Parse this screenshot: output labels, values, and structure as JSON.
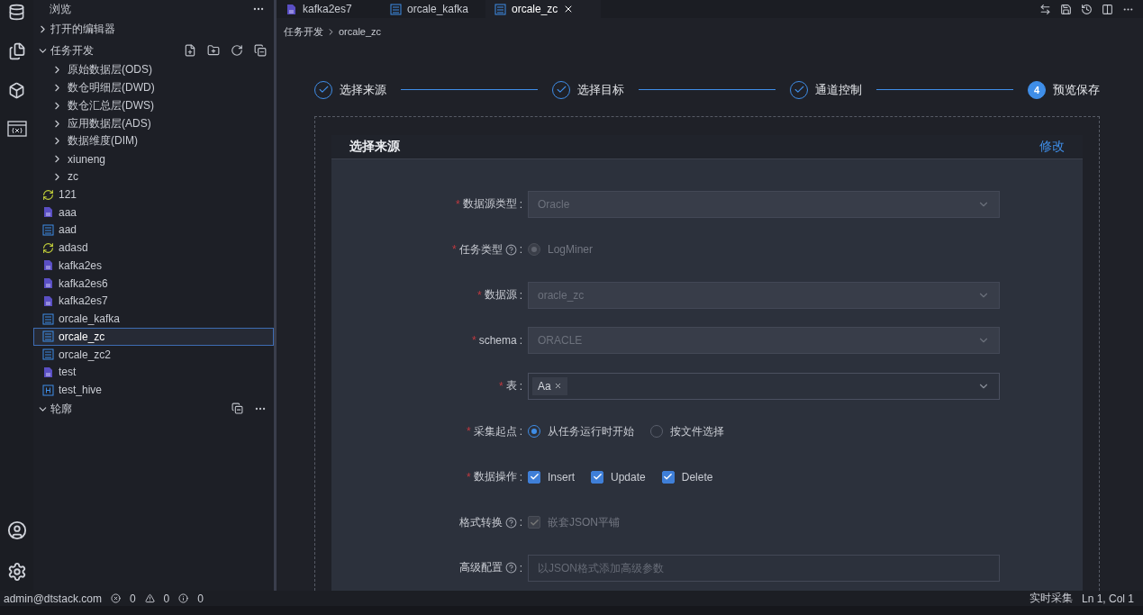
{
  "sidebar": {
    "title": "浏览",
    "sections": [
      {
        "label": "打开的编辑器",
        "expanded": false
      },
      {
        "label": "任务开发",
        "expanded": true
      }
    ],
    "items": [
      {
        "kind": "folder",
        "label": "原始数据层(ODS)",
        "selected": false
      },
      {
        "kind": "folder",
        "label": "数仓明细层(DWD)",
        "selected": false
      },
      {
        "kind": "folder",
        "label": "数仓汇总层(DWS)",
        "selected": false
      },
      {
        "kind": "folder",
        "label": "应用数据层(ADS)",
        "selected": false
      },
      {
        "kind": "folder",
        "label": "数据维度(DIM)",
        "selected": false
      },
      {
        "kind": "folder",
        "label": "xiuneng",
        "selected": false
      },
      {
        "kind": "folder",
        "label": "zc",
        "selected": false
      },
      {
        "kind": "sync",
        "label": "121",
        "selected": false
      },
      {
        "kind": "kafka",
        "label": "aaa",
        "selected": false
      },
      {
        "kind": "oracle",
        "label": "aad",
        "selected": false
      },
      {
        "kind": "sync",
        "label": "adasd",
        "selected": false
      },
      {
        "kind": "kafka",
        "label": "kafka2es",
        "selected": false
      },
      {
        "kind": "kafka",
        "label": "kafka2es6",
        "selected": false
      },
      {
        "kind": "kafka",
        "label": "kafka2es7",
        "selected": false
      },
      {
        "kind": "oracle",
        "label": "orcale_kafka",
        "selected": false
      },
      {
        "kind": "oracle",
        "label": "orcale_zc",
        "selected": true
      },
      {
        "kind": "oracle",
        "label": "orcale_zc2",
        "selected": false
      },
      {
        "kind": "kafka",
        "label": "test",
        "selected": false
      },
      {
        "kind": "hive",
        "label": "test_hive",
        "selected": false
      }
    ],
    "outline": {
      "label": "轮廓",
      "expanded": true
    }
  },
  "tabs": [
    {
      "kind": "kafka",
      "label": "kafka2es7",
      "selected": false
    },
    {
      "kind": "oracle",
      "label": "orcale_kafka",
      "selected": false
    },
    {
      "kind": "oracle",
      "label": "orcale_zc",
      "selected": true
    }
  ],
  "breadcrumb": [
    "任务开发",
    "orcale_zc"
  ],
  "steps": [
    {
      "label": "选择来源",
      "done": true
    },
    {
      "label": "选择目标",
      "done": true
    },
    {
      "label": "通道控制",
      "done": true
    },
    {
      "label": "预览保存",
      "done": false,
      "number": "4"
    }
  ],
  "card": {
    "title": "选择来源",
    "action": "修改"
  },
  "form": [
    {
      "kind": "select",
      "marker": "*",
      "label": "数据源类型",
      "help": false,
      "suffix": ":",
      "value": "Oracle"
    },
    {
      "kind": "radio",
      "marker": "*",
      "label": "任务类型",
      "help": true,
      "suffix": ":",
      "options": [
        {
          "label": "LogMiner",
          "selected": true,
          "disabled": true
        }
      ]
    },
    {
      "kind": "select",
      "marker": "*",
      "label": "数据源",
      "help": false,
      "suffix": ":",
      "value": "oracle_zc"
    },
    {
      "kind": "select",
      "marker": "*",
      "label": "schema",
      "help": false,
      "suffix": ":",
      "value": "ORACLE"
    },
    {
      "kind": "tags",
      "marker": "*",
      "label": "表",
      "help": false,
      "suffix": ":",
      "tags": [
        "Aa"
      ]
    },
    {
      "kind": "radio",
      "marker": "*",
      "label": "采集起点",
      "help": false,
      "suffix": ":",
      "options": [
        {
          "label": "从任务运行时开始",
          "selected": true,
          "disabled": false
        },
        {
          "label": "按文件选择",
          "selected": false,
          "disabled": false
        }
      ]
    },
    {
      "kind": "checks",
      "marker": "*",
      "label": "数据操作",
      "help": false,
      "suffix": ":",
      "options": [
        {
          "label": "Insert",
          "checked": true,
          "disabled": false
        },
        {
          "label": "Update",
          "checked": true,
          "disabled": false
        },
        {
          "label": "Delete",
          "checked": true,
          "disabled": false
        }
      ]
    },
    {
      "kind": "checks",
      "label": "格式转换",
      "help": true,
      "suffix": ":",
      "options": [
        {
          "label": "嵌套JSON平铺",
          "checked": true,
          "disabled": true
        }
      ]
    },
    {
      "kind": "textarea",
      "label": "高级配置",
      "help": true,
      "suffix": ":",
      "placeholder": "以JSON格式添加高级参数"
    }
  ],
  "status_bar": {
    "user": "admin@dtstack.com",
    "errors": "0",
    "warnings": "0",
    "infos": "0",
    "mode": "实时采集",
    "position": "Ln 1, Col 1"
  }
}
